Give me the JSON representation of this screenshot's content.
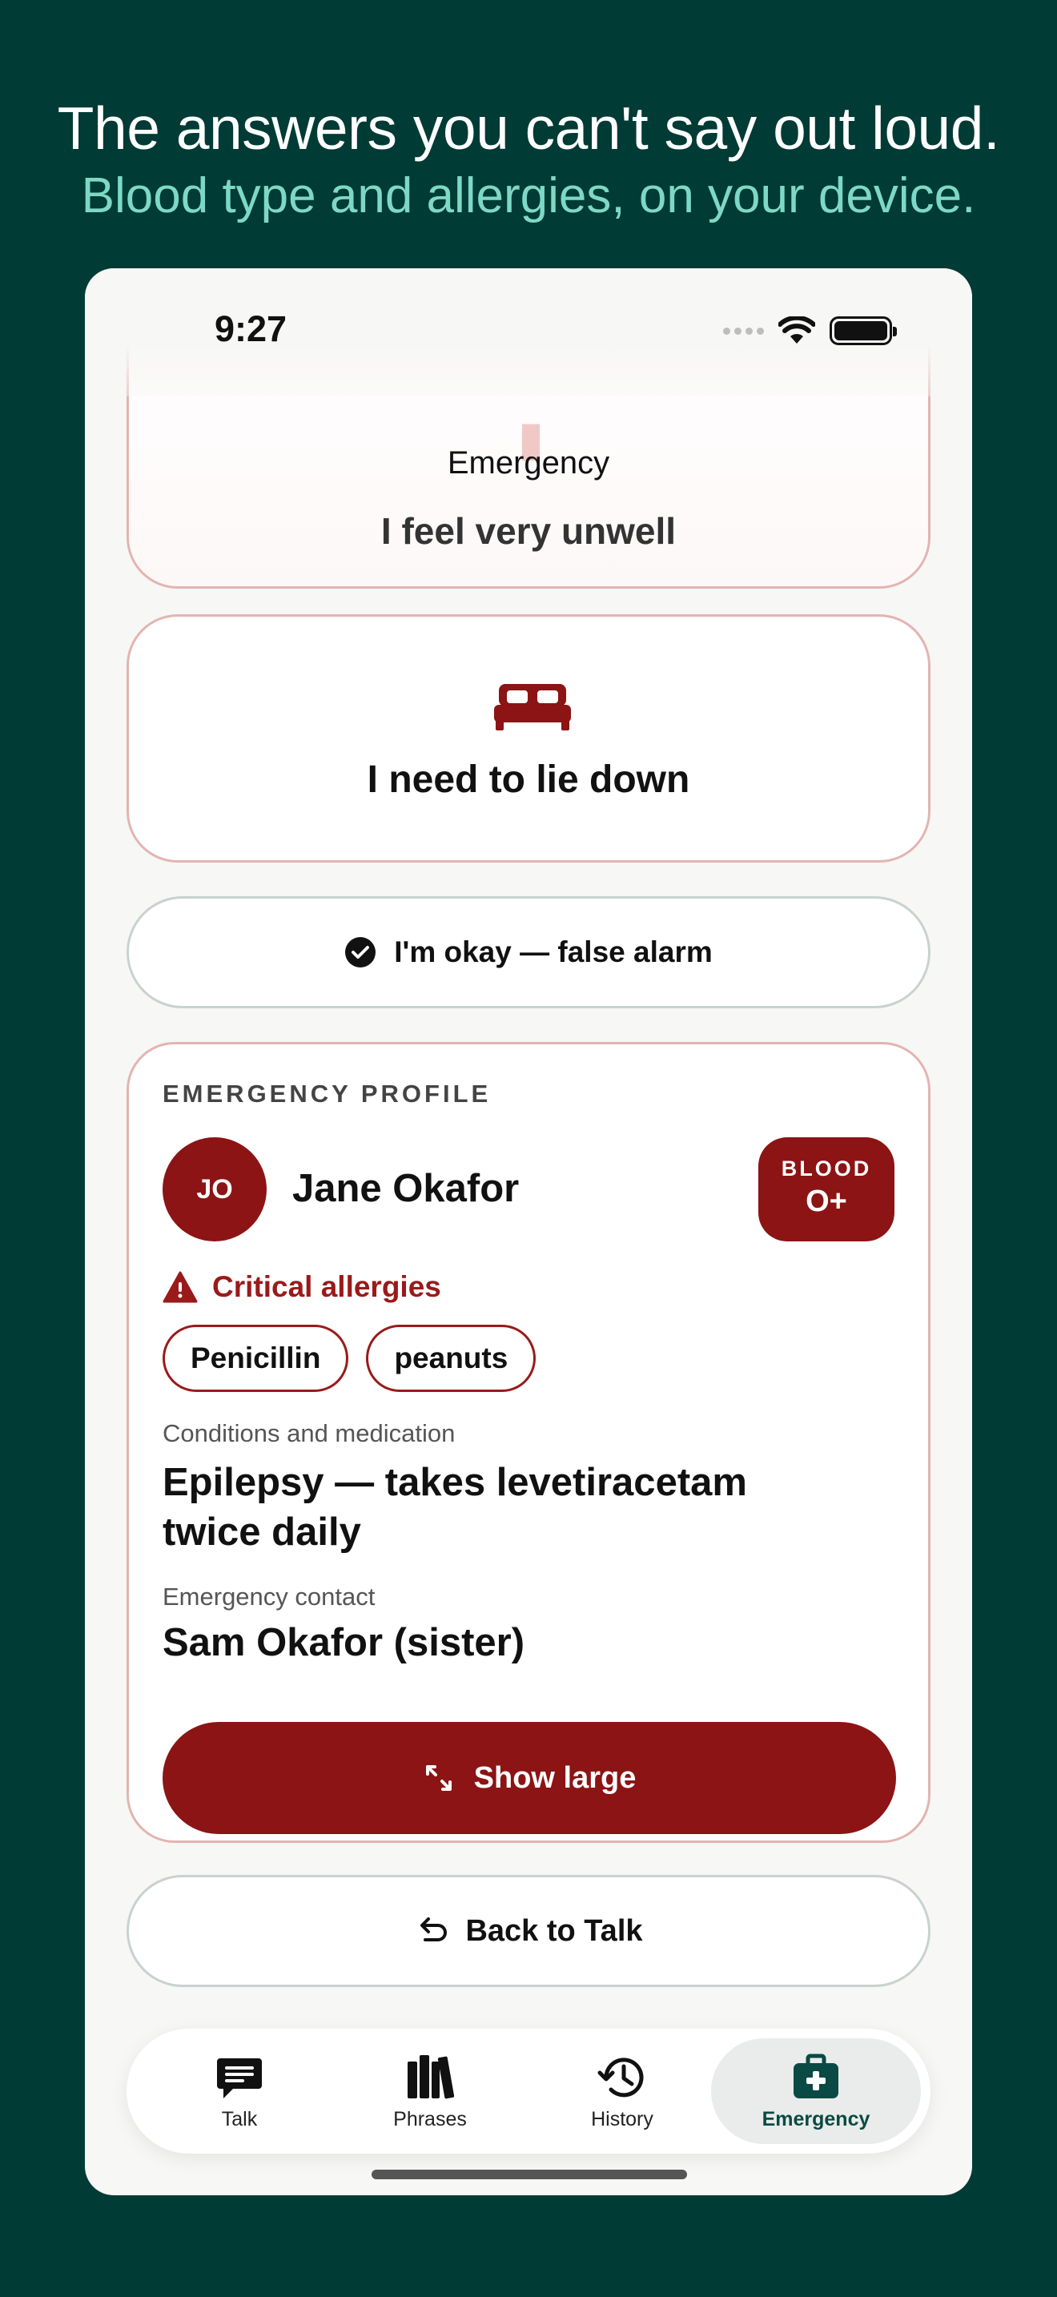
{
  "promo": {
    "headline": "The answers you can't say out loud.",
    "subline": "Blood type and allergies, on your device."
  },
  "status_bar": {
    "time": "9:27",
    "icons": [
      "wifi-icon",
      "battery-icon"
    ]
  },
  "phrases": {
    "top_card": {
      "category": "Emergency",
      "text": "I feel very unwell"
    },
    "lie_down": {
      "text": "I need to lie down",
      "icon": "bed-icon"
    },
    "okay_button": {
      "label": "I'm okay — false alarm",
      "icon": "check-circle-icon"
    }
  },
  "profile": {
    "section_title": "EMERGENCY PROFILE",
    "initials": "JO",
    "name": "Jane Okafor",
    "blood_label": "BLOOD",
    "blood_type": "O+",
    "allergies_title": "Critical allergies",
    "allergies": [
      "Penicillin",
      "peanuts"
    ],
    "conditions_label": "Conditions and medication",
    "conditions_value": "Epilepsy — takes levetiracetam twice daily",
    "contact_label": "Emergency contact",
    "contact_value": "Sam Okafor (sister)",
    "show_large_label": "Show large"
  },
  "back_button": {
    "label": "Back to Talk"
  },
  "tabs": [
    {
      "label": "Talk",
      "icon": "chat-icon",
      "active": false
    },
    {
      "label": "Phrases",
      "icon": "books-icon",
      "active": false
    },
    {
      "label": "History",
      "icon": "history-icon",
      "active": false
    },
    {
      "label": "Emergency",
      "icon": "medkit-icon",
      "active": true
    }
  ],
  "colors": {
    "background": "#003B35",
    "accent_text": "#7ED8C6",
    "emergency_red": "#8C1414",
    "active_tab": "#0A4A44"
  }
}
